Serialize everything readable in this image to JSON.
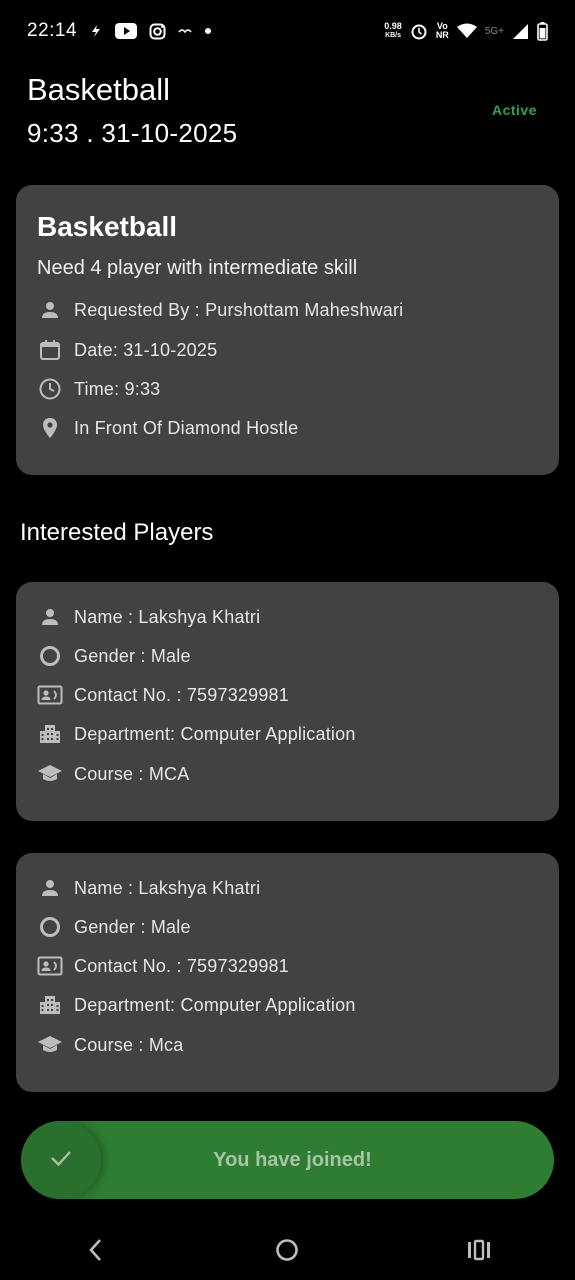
{
  "status_bar": {
    "time": "22:14",
    "net_speed_value": "0.98",
    "net_speed_unit": "KB/s",
    "volte_line1": "Vo",
    "volte_line2": "NR",
    "network_type": "5G+"
  },
  "header": {
    "sport": "Basketball",
    "datetime": "9:33 . 31-10-2025",
    "status": "Active",
    "status_color": "#2ea44f"
  },
  "request": {
    "title": "Basketball",
    "description": "Need 4 player with intermediate skill",
    "requested_by": "Requested By : Purshottam Maheshwari",
    "date": "Date: 31-10-2025",
    "time": "Time: 9:33",
    "location": "In Front Of Diamond Hostle"
  },
  "section_title": "Interested Players",
  "players": [
    {
      "name": "Name : Lakshya Khatri",
      "gender": "Gender : Male",
      "contact": "Contact No. : 7597329981",
      "department": "Department: Computer Application",
      "course": "Course : MCA"
    },
    {
      "name": "Name : Lakshya Khatri",
      "gender": "Gender : Male",
      "contact": "Contact No. : 7597329981",
      "department": "Department: Computer Application",
      "course": "Course : Mca"
    }
  ],
  "joined_label": "You have joined!",
  "joined_color": "#2e7d32",
  "icons": {
    "requested_by": "person-icon",
    "date": "calendar-icon",
    "time": "clock-icon",
    "location": "location-pin-icon",
    "gender": "circle-icon",
    "contact": "contact-card-icon",
    "department": "building-icon",
    "course": "graduation-cap-icon",
    "check": "check-icon"
  }
}
